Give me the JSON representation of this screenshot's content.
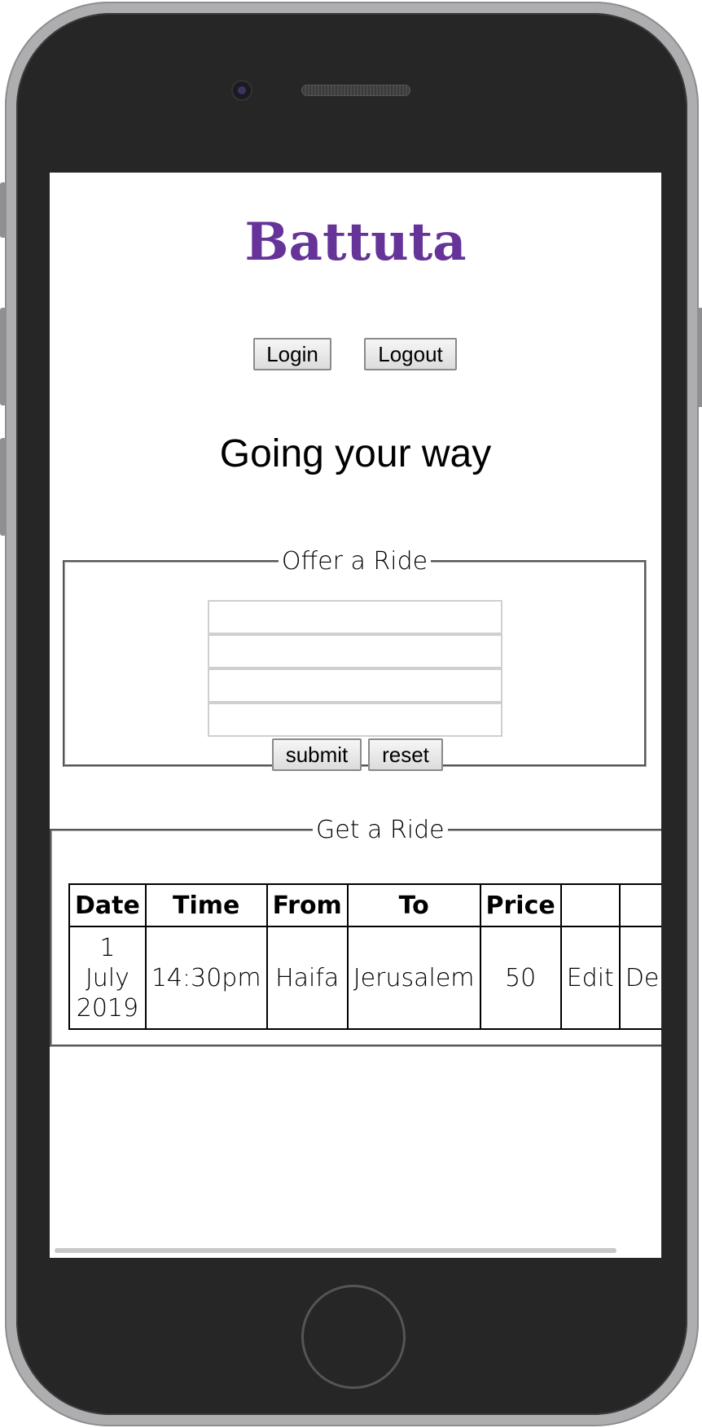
{
  "app": {
    "logo": "Battuta"
  },
  "header": {
    "login_label": "Login",
    "logout_label": "Logout"
  },
  "hero": {
    "title": "Going your way"
  },
  "offer": {
    "legend": "Offer a Ride",
    "fields": [
      "",
      "",
      "",
      ""
    ],
    "submit_label": "submit",
    "reset_label": "reset"
  },
  "get": {
    "legend": "Get a Ride",
    "columns": [
      "Date",
      "Time",
      "From",
      "To",
      "Price",
      "",
      ""
    ],
    "rows": [
      {
        "date_day": "1",
        "date_month": "July",
        "date_year": "2019",
        "time": "14:30pm",
        "from": "Haifa",
        "to": "Jerusalem",
        "price": "50",
        "edit": "Edit",
        "delete": "Delete"
      }
    ]
  }
}
